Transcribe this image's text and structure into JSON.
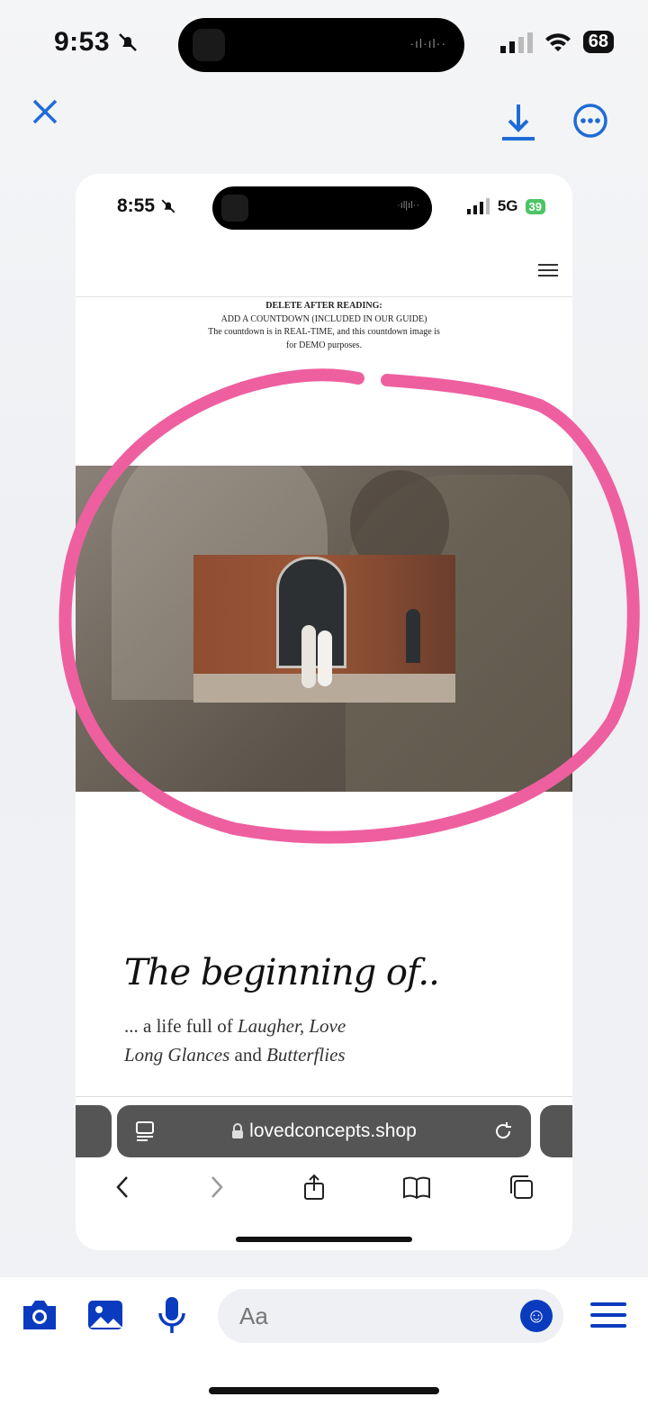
{
  "outer_status": {
    "time": "9:53",
    "battery": "68"
  },
  "viewer": {
    "close_icon": "✕",
    "download_icon": "⤓",
    "more_icon": "⋯"
  },
  "screenshot": {
    "status": {
      "time": "8:55",
      "network": "5G",
      "battery": "39"
    },
    "notice": {
      "heading": "DELETE AFTER READING:",
      "line1": "ADD A COUNTDOWN (INCLUDED IN OUR GUIDE)",
      "line2": "The countdown is in REAL-TIME, and this countdown image is",
      "line3": "for DEMO purposes."
    },
    "script_title": "The beginning of..",
    "subtitle_line1_prefix": "... a life full of ",
    "subtitle_line1_italic": "Laugher, Love",
    "subtitle_line2_italic1": "Long Glances",
    "subtitle_line2_mid": " and ",
    "subtitle_line2_italic2": "Butterflies",
    "browser": {
      "url": "lovedconcepts.shop"
    }
  },
  "composer": {
    "placeholder": "Aa"
  },
  "colors": {
    "accent": "#1f6bd6",
    "composer_blue": "#0a3bbf",
    "annotation_pink": "#ee5fa0"
  }
}
